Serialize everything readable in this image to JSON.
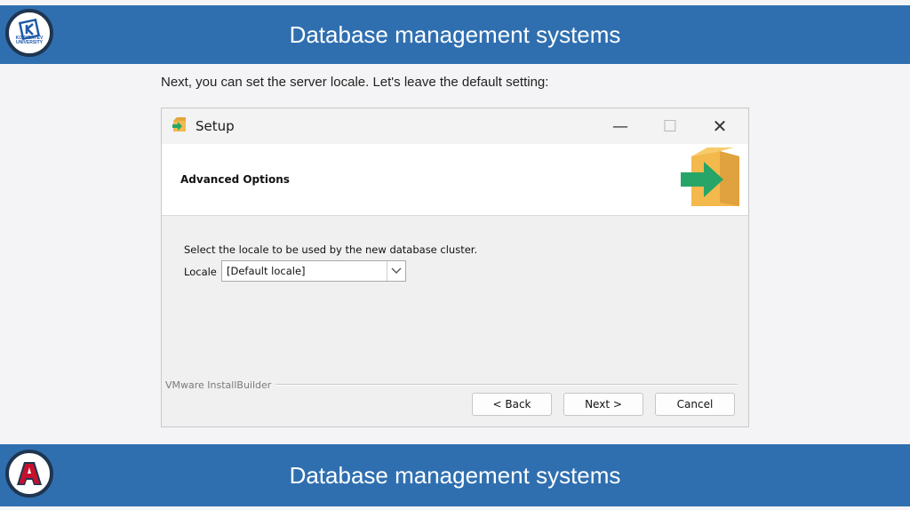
{
  "header": {
    "title": "Database management systems",
    "logo_text": "KOZYBAYEV UNIVERSITY"
  },
  "footer_banner": {
    "title": "Database management systems",
    "logo_letter": "A"
  },
  "intro_text": "Next, you can set the server locale. Let's leave the default setting:",
  "dialog": {
    "title": "Setup",
    "window_controls": {
      "minimize": "—",
      "maximize": "☐",
      "close": "✕"
    },
    "header_title": "Advanced Options",
    "instruction": "Select the locale to be used by the new database cluster.",
    "locale_label": "Locale",
    "locale_value": "[Default locale]",
    "footer_brand": "VMware InstallBuilder",
    "buttons": {
      "back": "< Back",
      "next": "Next >",
      "cancel": "Cancel"
    }
  },
  "colors": {
    "banner": "#2f6fb0",
    "logo_border": "#1f3550",
    "university_blue": "#1e5aa8",
    "arizona_red": "#c8102e",
    "box_orange": "#f3b94d",
    "arrow_green": "#27a568"
  },
  "icons": {
    "app_icon": "installer-box-icon",
    "header_art": "box-arrow-icon",
    "dropdown": "chevron-down-icon"
  }
}
